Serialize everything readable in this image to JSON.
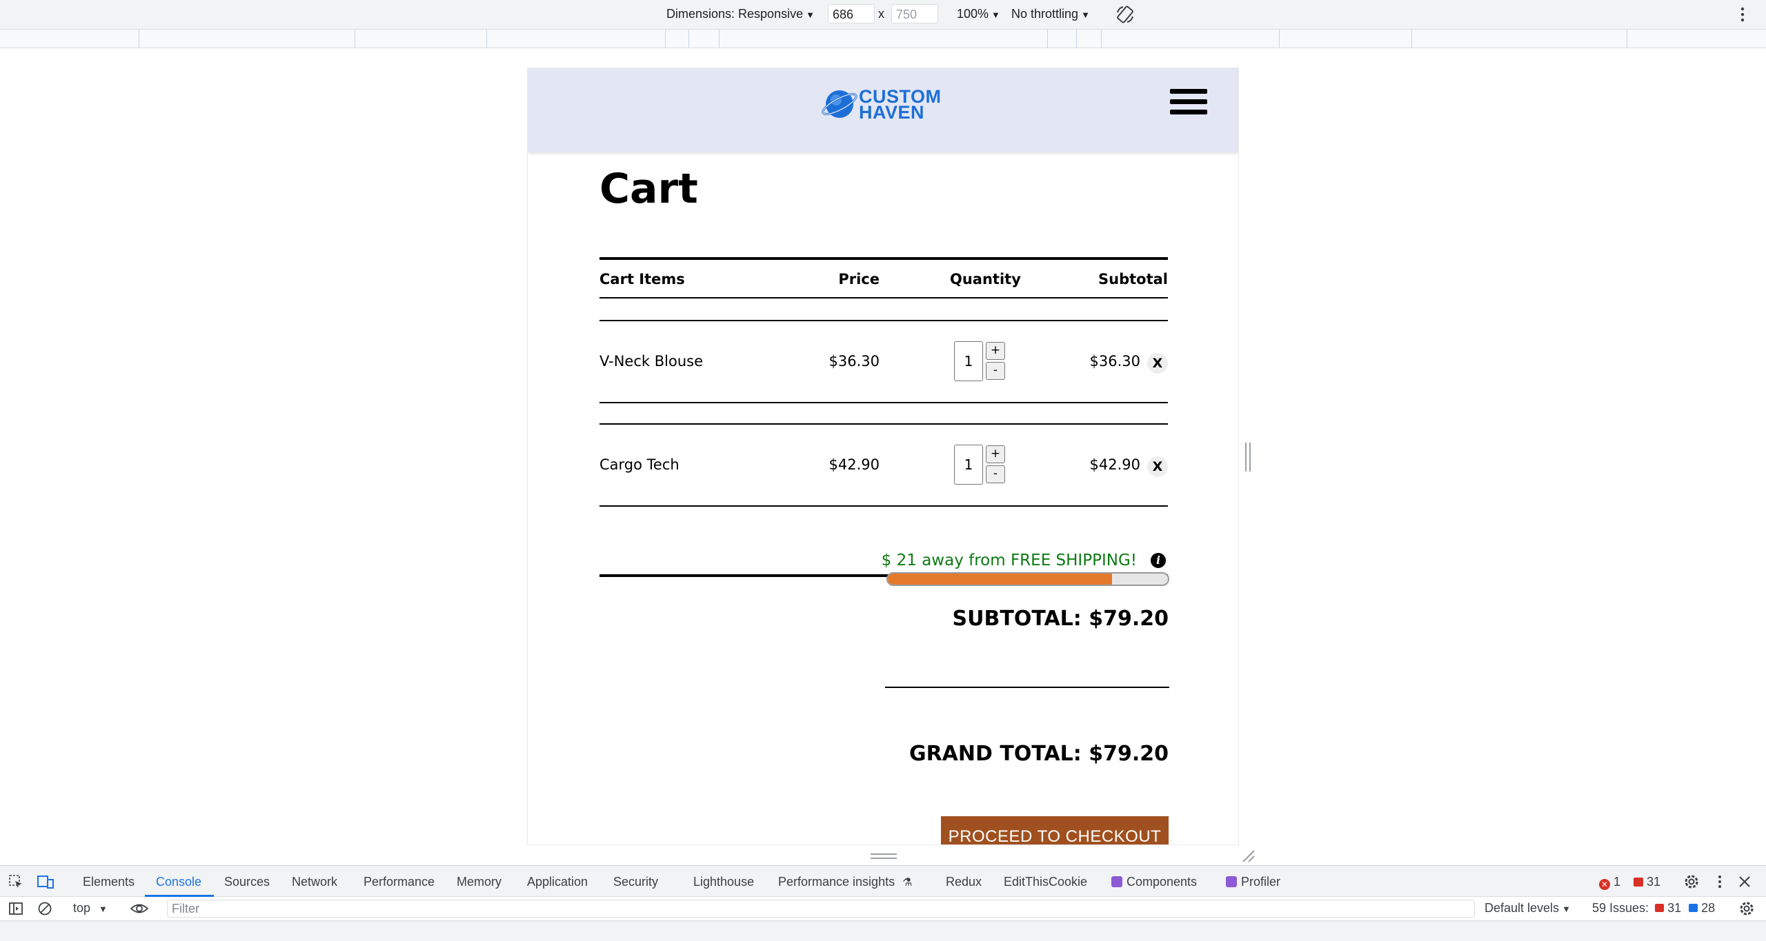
{
  "devtools_toolbar": {
    "dimensions_label": "Dimensions: Responsive",
    "width_value": "686",
    "height_placeholder": "750",
    "times_sign": "x",
    "zoom": "100%",
    "throttling": "No throttling"
  },
  "site": {
    "logo_line1": "CUSTOM",
    "logo_line2": "HAVEN",
    "page_title": "Cart",
    "table_headers": {
      "items": "Cart Items",
      "price": "Price",
      "quantity": "Quantity",
      "subtotal": "Subtotal"
    },
    "cart_items": [
      {
        "name": "V-Neck Blouse",
        "price": "$36.30",
        "quantity": "1",
        "subtotal": "$36.30"
      },
      {
        "name": "Cargo Tech",
        "price": "$42.90",
        "quantity": "1",
        "subtotal": "$42.90"
      }
    ],
    "plus_label": "+",
    "minus_label": "-",
    "remove_label": "X",
    "shipping_message": "$ 21 away from FREE SHIPPING!",
    "info_glyph": "i",
    "shipping_progress_fraction": 0.8,
    "subtotal": "SUBTOTAL: $79.20",
    "grand_total": "GRAND TOTAL: $79.20",
    "checkout_button": "PROCEED TO CHECKOUT"
  },
  "devtools": {
    "tabs": [
      "Elements",
      "Console",
      "Sources",
      "Network",
      "Performance",
      "Memory",
      "Application",
      "Security",
      "Lighthouse",
      "Performance insights",
      "Redux",
      "EditThisCookie",
      "Components",
      "Profiler"
    ],
    "active_tab": "Console",
    "error_count": "1",
    "warning_count": "31",
    "context": "top",
    "filter_placeholder": "Filter",
    "levels": "Default levels",
    "issues_label": "59 Issues:",
    "issues_warnings": "31",
    "issues_info": "28"
  },
  "colors": {
    "header_bg": "#e3e6f3",
    "logo_blue": "#1d6fd8",
    "shipping_green": "#0d7a13",
    "progress_orange": "#e57a2d",
    "checkout_brown": "#a0501f",
    "devtools_accent": "#1a73e8"
  },
  "icons": [
    "inspect-icon",
    "device-toggle-icon",
    "rotate-icon",
    "more-vert-icon",
    "hamburger-menu-icon",
    "info-icon",
    "settings-icon",
    "close-icon",
    "sidebar-icon",
    "clear-console-icon",
    "eye-icon",
    "error-icon",
    "warning-icon",
    "message-icon"
  ]
}
